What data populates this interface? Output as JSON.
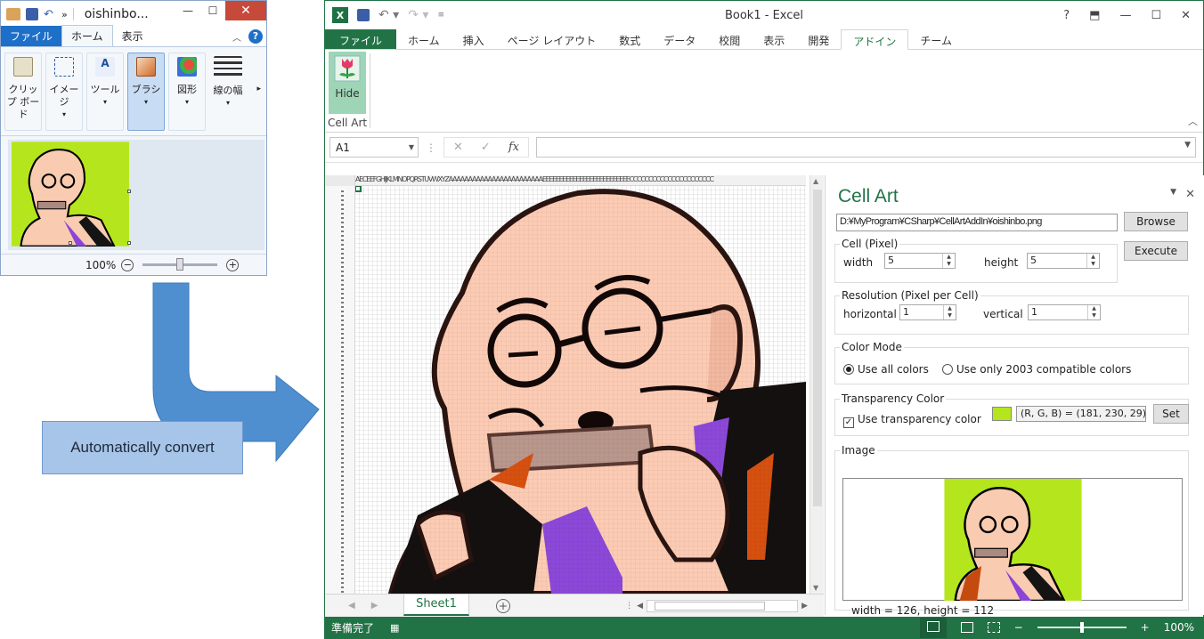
{
  "paint": {
    "title": "oishinbo...",
    "overflow": "»",
    "tabs": [
      "ファイル",
      "ホーム",
      "表示"
    ],
    "tools": [
      {
        "label": "クリップ ボード",
        "icon": "clipboard-icon"
      },
      {
        "label": "イメージ",
        "icon": "select-icon"
      },
      {
        "label": "ツール",
        "icon": "tools-icon"
      },
      {
        "label": "ブラシ",
        "icon": "brush-icon"
      },
      {
        "label": "図形",
        "icon": "shapes-icon"
      },
      {
        "label": "線の幅",
        "icon": "line-width-icon"
      }
    ],
    "zoom": "100%"
  },
  "note": {
    "text": "Automatically convert"
  },
  "excel": {
    "window_title": "Book1 - Excel",
    "tabs": [
      "ファイル",
      "ホーム",
      "挿入",
      "ページ レイアウト",
      "数式",
      "データ",
      "校閲",
      "表示",
      "開発",
      "アドイン",
      "チーム"
    ],
    "active_tab": "アドイン",
    "ribbon": {
      "hide_label": "Hide",
      "group_label": "Cell Art"
    },
    "name_box": "A1",
    "formula": "",
    "col_header_text": "AECEEFGHIJKLMNOPQRSTUVWXYZAAAAAAAAAAAAAAAAAAAAAAAAEEEEEEEEEEEEEEEEEEEEEEEEEECCCCCCCCCCCCCCCCCCCCCC",
    "sheet_tab": "Sheet1",
    "status": "準備完了",
    "zoom": "100%"
  },
  "pane": {
    "title": "Cell Art",
    "path": "D:¥MyProgram¥CSharp¥CellArtAddIn¥oishinbo.png",
    "browse": "Browse",
    "execute": "Execute",
    "cell_group": "Cell (Pixel)",
    "width_label": "width",
    "width_value": "5",
    "height_label": "height",
    "height_value": "5",
    "resolution_group": "Resolution (Pixel per Cell)",
    "horizontal_label": "horizontal",
    "horizontal_value": "1",
    "vertical_label": "vertical",
    "vertical_value": "1",
    "color_mode_group": "Color Mode",
    "opt_all": "Use all colors",
    "opt_2003": "Use only 2003 compatible colors",
    "transparency_group": "Transparency Color",
    "use_transparency": "Use transparency color",
    "rgb": "(R, G, B) = (181, 230, 29)",
    "swatch_color": "#b5e61d",
    "set": "Set",
    "image_group": "Image",
    "dimensions": "width = 126, height = 112"
  }
}
